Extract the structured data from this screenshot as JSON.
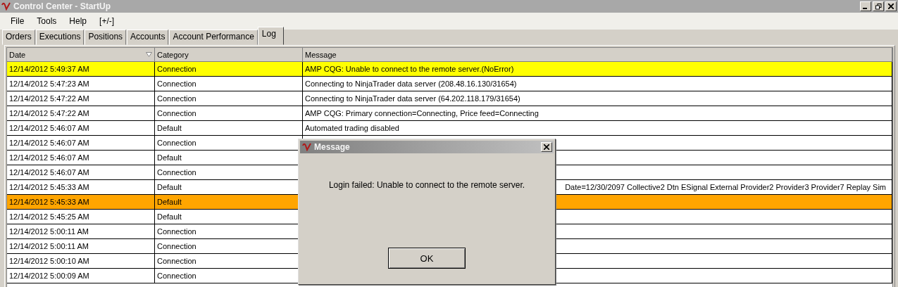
{
  "window": {
    "title": "Control Center - StartUp"
  },
  "menu": [
    "File",
    "Tools",
    "Help",
    "[+/-]"
  ],
  "tabs": [
    {
      "label": "Orders",
      "selected": false
    },
    {
      "label": "Executions",
      "selected": false
    },
    {
      "label": "Positions",
      "selected": false
    },
    {
      "label": "Accounts",
      "selected": false
    },
    {
      "label": "Account Performance",
      "selected": false
    },
    {
      "label": "Log",
      "selected": true
    }
  ],
  "table": {
    "columns": [
      "Date",
      "Category",
      "Message"
    ],
    "rows": [
      {
        "date": "12/14/2012 5:49:37 AM",
        "category": "Connection",
        "message": "AMP CQG: Unable to connect to the remote server.(NoError)",
        "color": "#ffff00"
      },
      {
        "date": "12/14/2012 5:47:23 AM",
        "category": "Connection",
        "message": "Connecting to NinjaTrader data server (208.48.16.130/31654)"
      },
      {
        "date": "12/14/2012 5:47:22 AM",
        "category": "Connection",
        "message": "Connecting to NinjaTrader data server (64.202.118.179/31654)"
      },
      {
        "date": "12/14/2012 5:47:22 AM",
        "category": "Connection",
        "message": "AMP CQG: Primary connection=Connecting, Price feed=Connecting"
      },
      {
        "date": "12/14/2012 5:46:07 AM",
        "category": "Default",
        "message": "Automated trading disabled"
      },
      {
        "date": "12/14/2012 5:46:07 AM",
        "category": "Connection"
      },
      {
        "date": "12/14/2012 5:46:07 AM",
        "category": "Default"
      },
      {
        "date": "12/14/2012 5:46:07 AM",
        "category": "Connection"
      },
      {
        "date": "12/14/2012 5:45:33 AM",
        "category": "Default",
        "message": "Date=12/30/2097 Collective2 Dtn ESignal External Provider2 Provider3 Provider7 Replay Sim",
        "partial": true
      },
      {
        "date": "12/14/2012 5:45:33 AM",
        "category": "Default",
        "color": "#ffa500"
      },
      {
        "date": "12/14/2012 5:45:25 AM",
        "category": "Default"
      },
      {
        "date": "12/14/2012 5:00:11 AM",
        "category": "Connection"
      },
      {
        "date": "12/14/2012 5:00:11 AM",
        "category": "Connection"
      },
      {
        "date": "12/14/2012 5:00:10 AM",
        "category": "Connection"
      },
      {
        "date": "12/14/2012 5:00:09 AM",
        "category": "Connection"
      }
    ]
  },
  "dialog": {
    "title": "Message",
    "text": "Login failed: Unable to connect to the remote server.",
    "button": "OK"
  }
}
